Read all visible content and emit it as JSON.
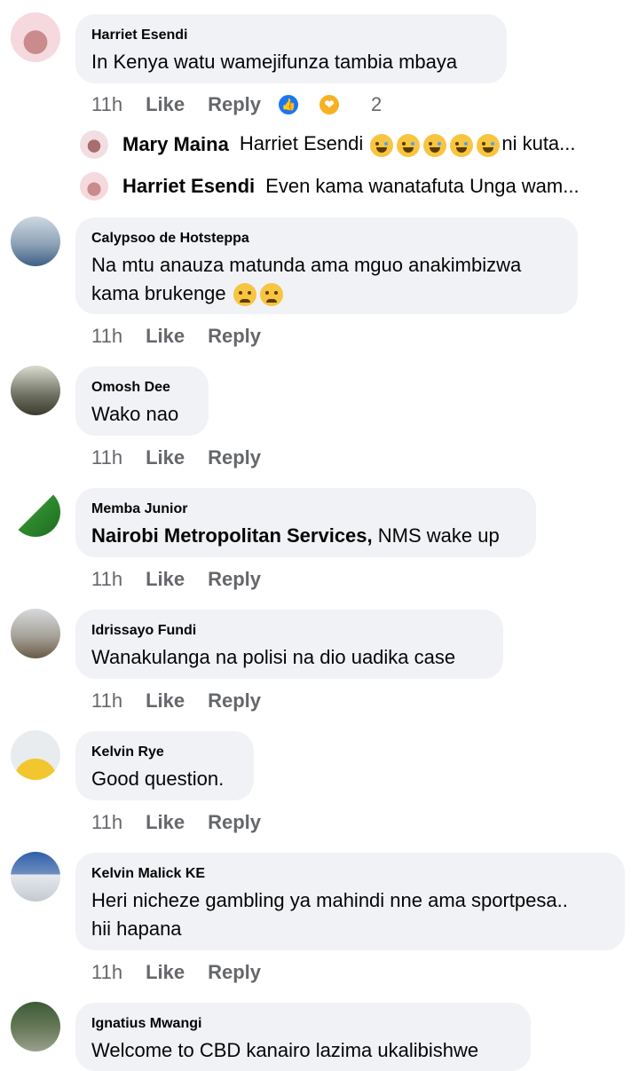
{
  "comments": [
    {
      "name": "Harriet Esendi",
      "text": "In Kenya watu wamejifunza tambia mbaya",
      "time": "11h",
      "like": "Like",
      "reply": "Reply",
      "reaction_count": "2"
    },
    {
      "name": "Calypsoo de Hotsteppa",
      "text_line1": "Na mtu anauza matunda ama mguo anakimbizwa",
      "text_line2": "kama brukenge",
      "time": "11h",
      "like": "Like",
      "reply": "Reply"
    },
    {
      "name": "Omosh Dee",
      "text": "Wako nao",
      "time": "11h",
      "like": "Like",
      "reply": "Reply"
    },
    {
      "name": "Memba Junior",
      "mention": "Nairobi Metropolitan Services,",
      "text": " NMS wake up",
      "time": "11h",
      "like": "Like",
      "reply": "Reply"
    },
    {
      "name": "Idrissayo Fundi",
      "text": "Wanakulanga na polisi na dio uadika case",
      "time": "11h",
      "like": "Like",
      "reply": "Reply"
    },
    {
      "name": "Kelvin Rye",
      "text": "Good question.",
      "time": "11h",
      "like": "Like",
      "reply": "Reply"
    },
    {
      "name": "Kelvin Malick KE",
      "text_line1": "Heri nicheze gambling ya mahindi nne ama sportpesa..",
      "text_line2": "hii hapana",
      "time": "11h",
      "like": "Like",
      "reply": "Reply"
    },
    {
      "name": "Ignatius Mwangi",
      "text": "Welcome to CBD kanairo lazima ukalibishwe"
    }
  ],
  "replies": [
    {
      "name": "Mary Maina",
      "text_prefix": "Harriet Esendi",
      "text_suffix": "ni kuta..."
    },
    {
      "name": "Harriet Esendi",
      "text": "Even kama wanatafuta Unga wam..."
    }
  ],
  "colors": {
    "bubble": "#f0f2f5",
    "meta": "#65676b",
    "like_blue": "#1877f2"
  },
  "icons": {
    "reaction_like": "like-icon",
    "reaction_care": "care-icon",
    "emoji_laugh": "laugh-cry-icon",
    "emoji_sad": "pensive-icon"
  }
}
